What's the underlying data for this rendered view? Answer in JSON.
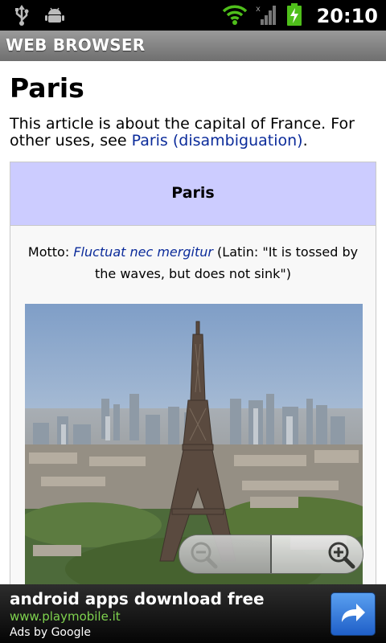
{
  "status_bar": {
    "time": "20:10",
    "icons": [
      "usb-icon",
      "android-debug-icon",
      "wifi-icon",
      "signal-icon",
      "battery-charging-icon"
    ]
  },
  "app": {
    "title": "WEB BROWSER"
  },
  "article": {
    "title": "Paris",
    "hatnote_text": "This article is about the capital of France. For other uses, see ",
    "hatnote_link": "Paris (disambiguation)",
    "hatnote_end": ".",
    "infobox": {
      "title": "Paris",
      "motto_label": "Motto: ",
      "motto_latin": "Fluctuat nec mergitur",
      "motto_translation": " (Latin: \"It is tossed by the waves, but does not sink\")"
    }
  },
  "zoom_controls": {
    "out_icon": "zoom-out-icon",
    "in_icon": "zoom-in-icon"
  },
  "ad": {
    "title": "android apps download free",
    "url": "www.playmobile.it",
    "byline": "Ads by Google",
    "button_icon": "share-arrow-icon"
  },
  "colors": {
    "link": "#0b2b9a",
    "infobox_header": "#ccccff",
    "ad_url": "#7fd34e",
    "ad_button": "#3a80e0"
  }
}
